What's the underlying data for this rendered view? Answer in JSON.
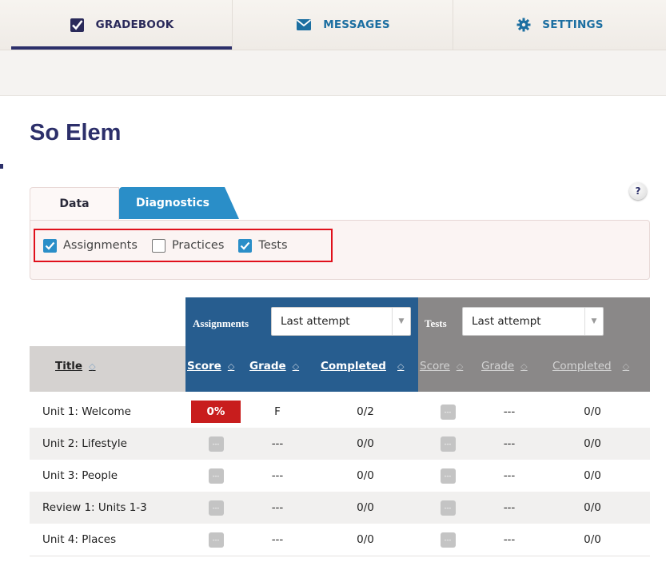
{
  "nav": {
    "tabs": [
      {
        "label": "GRADEBOOK",
        "icon": "checkbox-icon",
        "active": true
      },
      {
        "label": "MESSAGES",
        "icon": "envelope-icon",
        "active": false
      },
      {
        "label": "SETTINGS",
        "icon": "gear-icon",
        "active": false
      }
    ]
  },
  "page": {
    "title": "So Elem"
  },
  "tabs": [
    {
      "label": "Data",
      "active": true
    },
    {
      "label": "Diagnostics",
      "active": false
    }
  ],
  "help": {
    "label": "?"
  },
  "filters": [
    {
      "label": "Assignments",
      "checked": true
    },
    {
      "label": "Practices",
      "checked": false
    },
    {
      "label": "Tests",
      "checked": true
    }
  ],
  "table": {
    "groups": {
      "assignments": {
        "label": "Assignments",
        "select_value": "Last attempt"
      },
      "tests": {
        "label": "Tests",
        "select_value": "Last attempt"
      }
    },
    "columns": {
      "title": "Title",
      "a_score": "Score",
      "a_grade": "Grade",
      "a_completed": "Completed",
      "t_score": "Score",
      "t_grade": "Grade",
      "t_completed": "Completed"
    },
    "sort_icon": "◇",
    "empty_score": "---",
    "rows": [
      {
        "title": "Unit 1: Welcome",
        "a_score": "0%",
        "a_grade": "F",
        "a_completed": "0/2",
        "t_grade": "---",
        "t_completed": "0/0"
      },
      {
        "title": "Unit 2: Lifestyle",
        "a_score": "---",
        "a_grade": "---",
        "a_completed": "0/0",
        "t_grade": "---",
        "t_completed": "0/0"
      },
      {
        "title": "Unit 3: People",
        "a_score": "---",
        "a_grade": "---",
        "a_completed": "0/0",
        "t_grade": "---",
        "t_completed": "0/0"
      },
      {
        "title": "Review 1: Units 1-3",
        "a_score": "---",
        "a_grade": "---",
        "a_completed": "0/0",
        "t_grade": "---",
        "t_completed": "0/0"
      },
      {
        "title": "Unit 4: Places",
        "a_score": "---",
        "a_grade": "---",
        "a_completed": "0/0",
        "t_grade": "---",
        "t_completed": "0/0"
      }
    ]
  },
  "colors": {
    "navy": "#2c2f6a",
    "blue": "#2a8ec8",
    "assign_header": "#275d8f",
    "tests_header": "#8a8888",
    "fail_red": "#c81d1d",
    "highlight": "#e0101b"
  }
}
